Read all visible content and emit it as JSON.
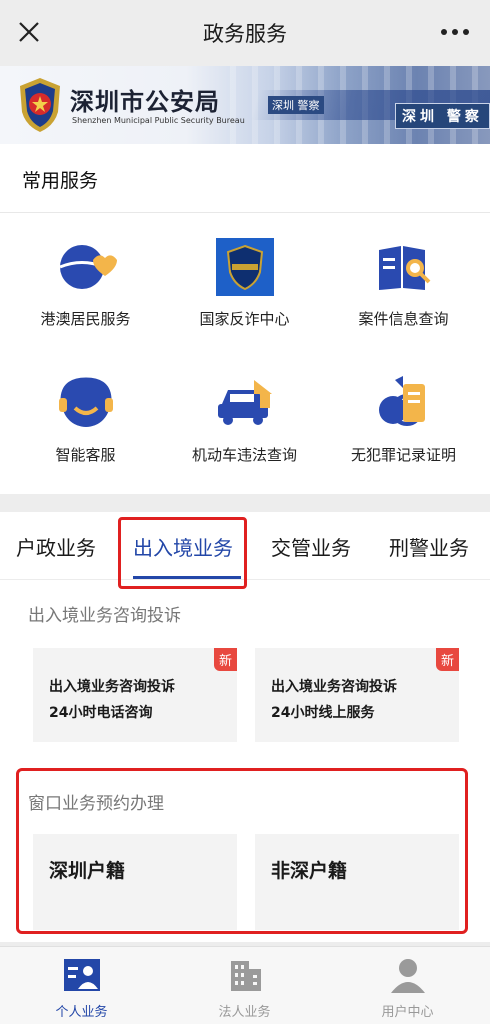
{
  "topbar": {
    "title": "政务服务",
    "close_icon": "close-icon",
    "more_icon": "more-icon"
  },
  "banner": {
    "org_name_cn": "深圳市公安局",
    "org_name_en": "Shenzhen Municipal Public Security Bureau",
    "sign_text": "深圳 警察",
    "sign_text_small": "深圳 警察"
  },
  "common_services": {
    "title": "常用服务",
    "items": [
      {
        "label": "港澳居民服务",
        "icon": "hk-macau-resident-icon"
      },
      {
        "label": "国家反诈中心",
        "icon": "anti-fraud-center-icon"
      },
      {
        "label": "案件信息查询",
        "icon": "case-query-icon"
      },
      {
        "label": "智能客服",
        "icon": "smart-service-icon"
      },
      {
        "label": "机动车违法查询",
        "icon": "vehicle-violation-icon"
      },
      {
        "label": "无犯罪记录证明",
        "icon": "no-criminal-record-icon"
      }
    ]
  },
  "tabs": {
    "items": [
      {
        "label": "户政业务"
      },
      {
        "label": "出入境业务"
      },
      {
        "label": "交管业务"
      },
      {
        "label": "刑警业务"
      }
    ],
    "active_index": 1
  },
  "consult": {
    "title": "出入境业务咨询投诉",
    "cards": [
      {
        "line1": "出入境业务咨询投诉",
        "line2": "24小时电话咨询",
        "badge": "新"
      },
      {
        "line1": "出入境业务咨询投诉",
        "line2": "24小时线上服务",
        "badge": "新"
      }
    ]
  },
  "appointment": {
    "title": "窗口业务预约办理",
    "cards": [
      {
        "label": "深圳户籍"
      },
      {
        "label": "非深户籍"
      }
    ]
  },
  "bottom_nav": {
    "items": [
      {
        "label": "个人业务",
        "icon": "personal-business-icon",
        "active": true
      },
      {
        "label": "法人业务",
        "icon": "corporate-business-icon",
        "active": false
      },
      {
        "label": "用户中心",
        "icon": "user-center-icon",
        "active": false
      }
    ]
  },
  "colors": {
    "accent": "#2347a8",
    "highlight_red": "#e02020",
    "badge_red": "#e8483f"
  }
}
